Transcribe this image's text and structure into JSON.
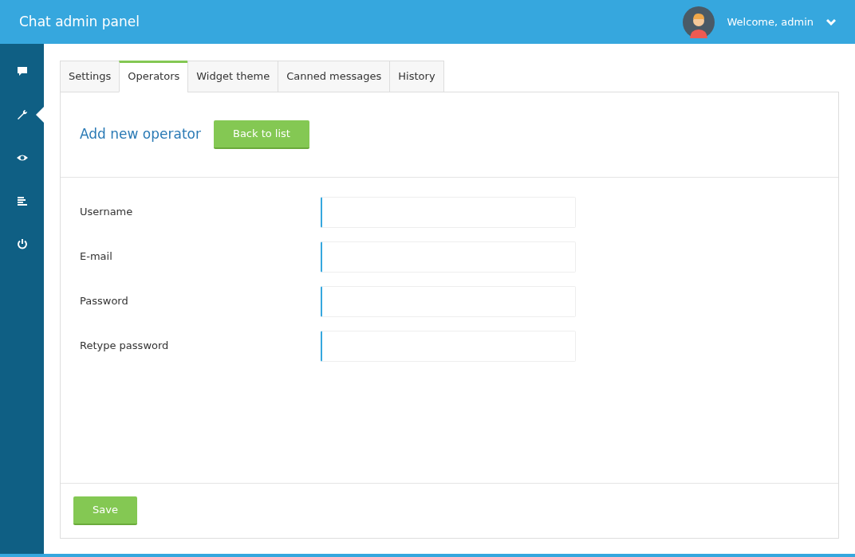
{
  "header": {
    "title": "Chat admin panel",
    "welcome": "Welcome, admin"
  },
  "sidebar": {
    "items": [
      {
        "kind": "chat",
        "selected": false
      },
      {
        "kind": "wrench",
        "selected": true
      },
      {
        "kind": "eye",
        "selected": false
      },
      {
        "kind": "list",
        "selected": false
      },
      {
        "kind": "power",
        "selected": false
      }
    ]
  },
  "tabs": [
    {
      "label": "Settings",
      "selected": false
    },
    {
      "label": "Operators",
      "selected": true
    },
    {
      "label": "Widget theme",
      "selected": false
    },
    {
      "label": "Canned messages",
      "selected": false
    },
    {
      "label": "History",
      "selected": false
    }
  ],
  "panel": {
    "heading": "Add new operator",
    "back_button": "Back to list",
    "fields": [
      {
        "label": "Username"
      },
      {
        "label": "E-mail"
      },
      {
        "label": "Password"
      },
      {
        "label": "Retype password"
      }
    ],
    "save_button": "Save"
  }
}
